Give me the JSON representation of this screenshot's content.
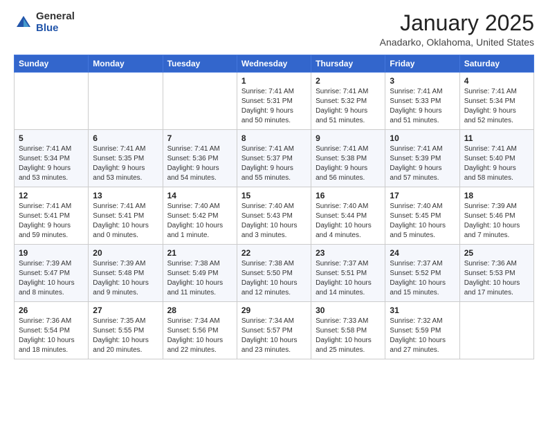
{
  "logo": {
    "general": "General",
    "blue": "Blue"
  },
  "header": {
    "title": "January 2025",
    "subtitle": "Anadarko, Oklahoma, United States"
  },
  "weekdays": [
    "Sunday",
    "Monday",
    "Tuesday",
    "Wednesday",
    "Thursday",
    "Friday",
    "Saturday"
  ],
  "weeks": [
    [
      {
        "day": "",
        "info": ""
      },
      {
        "day": "",
        "info": ""
      },
      {
        "day": "",
        "info": ""
      },
      {
        "day": "1",
        "info": "Sunrise: 7:41 AM\nSunset: 5:31 PM\nDaylight: 9 hours and 50 minutes."
      },
      {
        "day": "2",
        "info": "Sunrise: 7:41 AM\nSunset: 5:32 PM\nDaylight: 9 hours and 51 minutes."
      },
      {
        "day": "3",
        "info": "Sunrise: 7:41 AM\nSunset: 5:33 PM\nDaylight: 9 hours and 51 minutes."
      },
      {
        "day": "4",
        "info": "Sunrise: 7:41 AM\nSunset: 5:34 PM\nDaylight: 9 hours and 52 minutes."
      }
    ],
    [
      {
        "day": "5",
        "info": "Sunrise: 7:41 AM\nSunset: 5:34 PM\nDaylight: 9 hours and 53 minutes."
      },
      {
        "day": "6",
        "info": "Sunrise: 7:41 AM\nSunset: 5:35 PM\nDaylight: 9 hours and 53 minutes."
      },
      {
        "day": "7",
        "info": "Sunrise: 7:41 AM\nSunset: 5:36 PM\nDaylight: 9 hours and 54 minutes."
      },
      {
        "day": "8",
        "info": "Sunrise: 7:41 AM\nSunset: 5:37 PM\nDaylight: 9 hours and 55 minutes."
      },
      {
        "day": "9",
        "info": "Sunrise: 7:41 AM\nSunset: 5:38 PM\nDaylight: 9 hours and 56 minutes."
      },
      {
        "day": "10",
        "info": "Sunrise: 7:41 AM\nSunset: 5:39 PM\nDaylight: 9 hours and 57 minutes."
      },
      {
        "day": "11",
        "info": "Sunrise: 7:41 AM\nSunset: 5:40 PM\nDaylight: 9 hours and 58 minutes."
      }
    ],
    [
      {
        "day": "12",
        "info": "Sunrise: 7:41 AM\nSunset: 5:41 PM\nDaylight: 9 hours and 59 minutes."
      },
      {
        "day": "13",
        "info": "Sunrise: 7:41 AM\nSunset: 5:41 PM\nDaylight: 10 hours and 0 minutes."
      },
      {
        "day": "14",
        "info": "Sunrise: 7:40 AM\nSunset: 5:42 PM\nDaylight: 10 hours and 1 minute."
      },
      {
        "day": "15",
        "info": "Sunrise: 7:40 AM\nSunset: 5:43 PM\nDaylight: 10 hours and 3 minutes."
      },
      {
        "day": "16",
        "info": "Sunrise: 7:40 AM\nSunset: 5:44 PM\nDaylight: 10 hours and 4 minutes."
      },
      {
        "day": "17",
        "info": "Sunrise: 7:40 AM\nSunset: 5:45 PM\nDaylight: 10 hours and 5 minutes."
      },
      {
        "day": "18",
        "info": "Sunrise: 7:39 AM\nSunset: 5:46 PM\nDaylight: 10 hours and 7 minutes."
      }
    ],
    [
      {
        "day": "19",
        "info": "Sunrise: 7:39 AM\nSunset: 5:47 PM\nDaylight: 10 hours and 8 minutes."
      },
      {
        "day": "20",
        "info": "Sunrise: 7:39 AM\nSunset: 5:48 PM\nDaylight: 10 hours and 9 minutes."
      },
      {
        "day": "21",
        "info": "Sunrise: 7:38 AM\nSunset: 5:49 PM\nDaylight: 10 hours and 11 minutes."
      },
      {
        "day": "22",
        "info": "Sunrise: 7:38 AM\nSunset: 5:50 PM\nDaylight: 10 hours and 12 minutes."
      },
      {
        "day": "23",
        "info": "Sunrise: 7:37 AM\nSunset: 5:51 PM\nDaylight: 10 hours and 14 minutes."
      },
      {
        "day": "24",
        "info": "Sunrise: 7:37 AM\nSunset: 5:52 PM\nDaylight: 10 hours and 15 minutes."
      },
      {
        "day": "25",
        "info": "Sunrise: 7:36 AM\nSunset: 5:53 PM\nDaylight: 10 hours and 17 minutes."
      }
    ],
    [
      {
        "day": "26",
        "info": "Sunrise: 7:36 AM\nSunset: 5:54 PM\nDaylight: 10 hours and 18 minutes."
      },
      {
        "day": "27",
        "info": "Sunrise: 7:35 AM\nSunset: 5:55 PM\nDaylight: 10 hours and 20 minutes."
      },
      {
        "day": "28",
        "info": "Sunrise: 7:34 AM\nSunset: 5:56 PM\nDaylight: 10 hours and 22 minutes."
      },
      {
        "day": "29",
        "info": "Sunrise: 7:34 AM\nSunset: 5:57 PM\nDaylight: 10 hours and 23 minutes."
      },
      {
        "day": "30",
        "info": "Sunrise: 7:33 AM\nSunset: 5:58 PM\nDaylight: 10 hours and 25 minutes."
      },
      {
        "day": "31",
        "info": "Sunrise: 7:32 AM\nSunset: 5:59 PM\nDaylight: 10 hours and 27 minutes."
      },
      {
        "day": "",
        "info": ""
      }
    ]
  ]
}
